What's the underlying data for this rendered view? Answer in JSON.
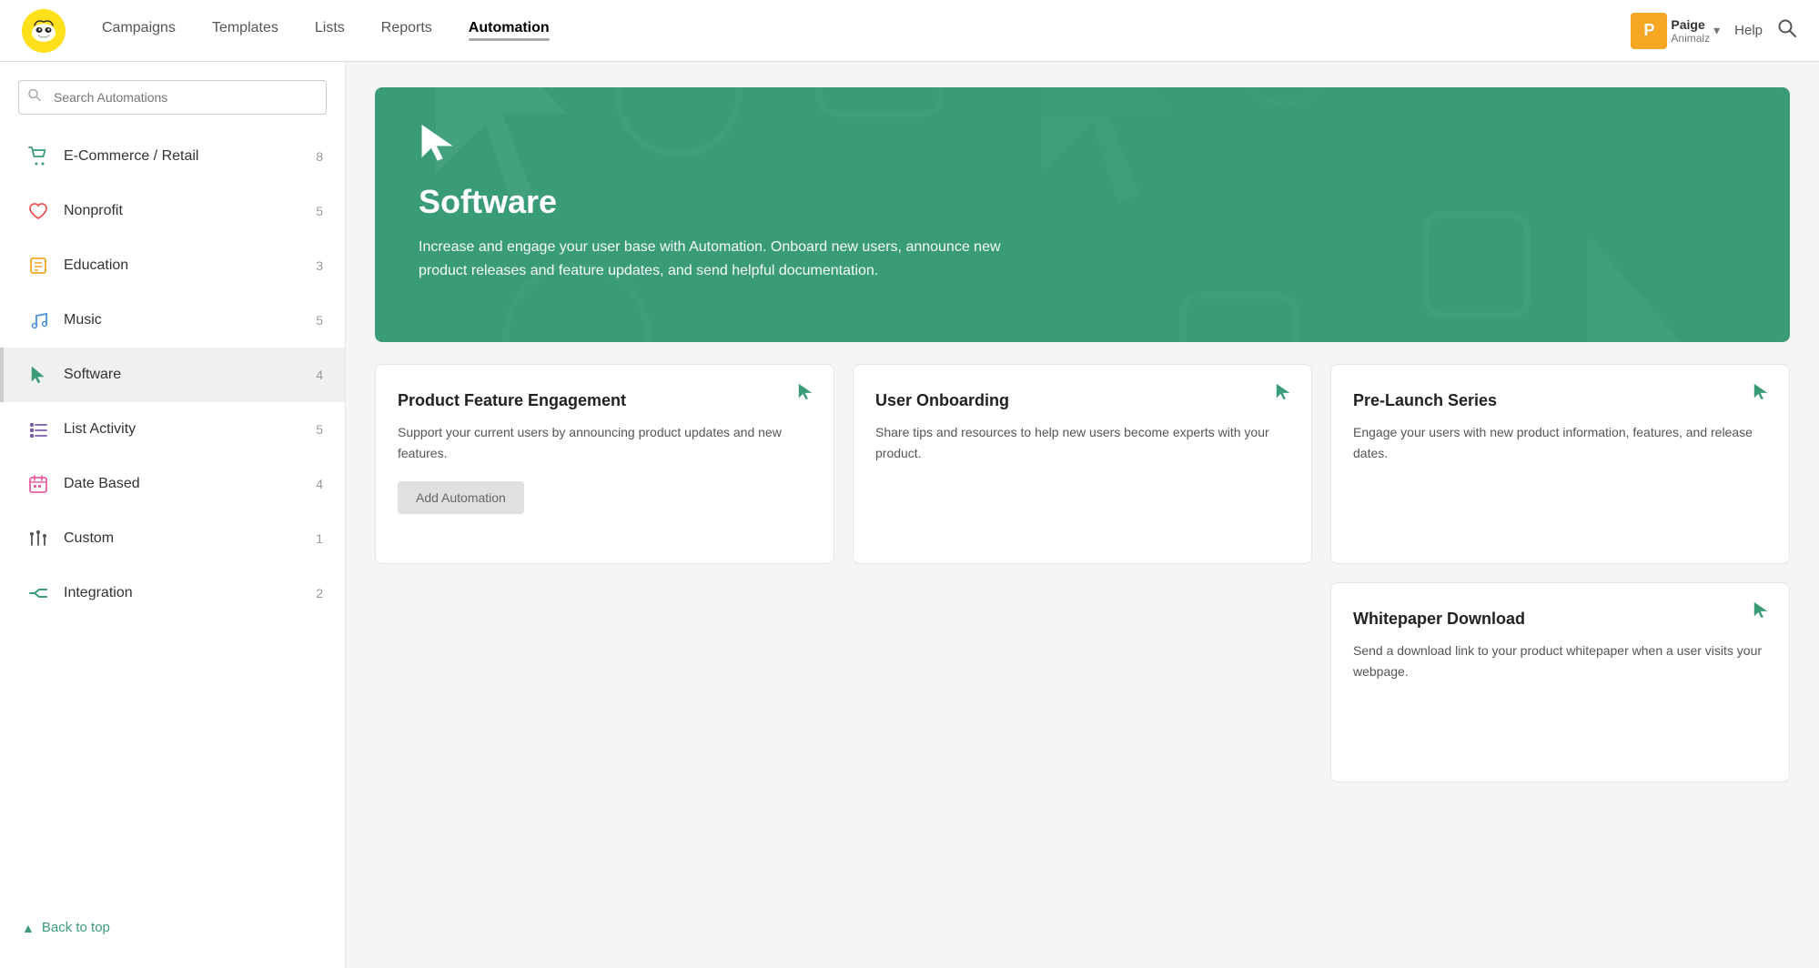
{
  "nav": {
    "links": [
      {
        "label": "Campaigns",
        "active": false
      },
      {
        "label": "Templates",
        "active": false
      },
      {
        "label": "Lists",
        "active": false
      },
      {
        "label": "Reports",
        "active": false
      },
      {
        "label": "Automation",
        "active": true
      }
    ],
    "user": {
      "initial": "P",
      "name": "Paige",
      "org": "Animalz"
    },
    "help_label": "Help"
  },
  "sidebar": {
    "search_placeholder": "Search Automations",
    "items": [
      {
        "label": "E-Commerce / Retail",
        "count": "8",
        "icon": "cart",
        "active": false
      },
      {
        "label": "Nonprofit",
        "count": "5",
        "icon": "heart",
        "active": false
      },
      {
        "label": "Education",
        "count": "3",
        "icon": "book",
        "active": false
      },
      {
        "label": "Music",
        "count": "5",
        "icon": "music",
        "active": false
      },
      {
        "label": "Software",
        "count": "4",
        "icon": "cursor",
        "active": true
      },
      {
        "label": "List Activity",
        "count": "5",
        "icon": "list",
        "active": false
      },
      {
        "label": "Date Based",
        "count": "4",
        "icon": "calendar",
        "active": false
      },
      {
        "label": "Custom",
        "count": "1",
        "icon": "custom",
        "active": false
      },
      {
        "label": "Integration",
        "count": "2",
        "icon": "integration",
        "active": false
      }
    ],
    "back_to_top": "Back to top"
  },
  "hero": {
    "title": "Software",
    "description": "Increase and engage your user base with Automation. Onboard new users, announce new product releases and feature updates, and send helpful documentation."
  },
  "cards": [
    {
      "title": "Product Feature Engagement",
      "description": "Support your current users by announcing product updates and new features.",
      "has_button": true,
      "button_label": "Add Automation"
    },
    {
      "title": "User Onboarding",
      "description": "Share tips and resources to help new users become experts with your product.",
      "has_button": false,
      "button_label": ""
    },
    {
      "title": "Pre-Launch Series",
      "description": "Engage your users with new product information, features, and release dates.",
      "has_button": false,
      "button_label": ""
    },
    {
      "title": "Whitepaper Download",
      "description": "Send a download link to your product whitepaper when a user visits your webpage.",
      "has_button": false,
      "button_label": ""
    }
  ]
}
